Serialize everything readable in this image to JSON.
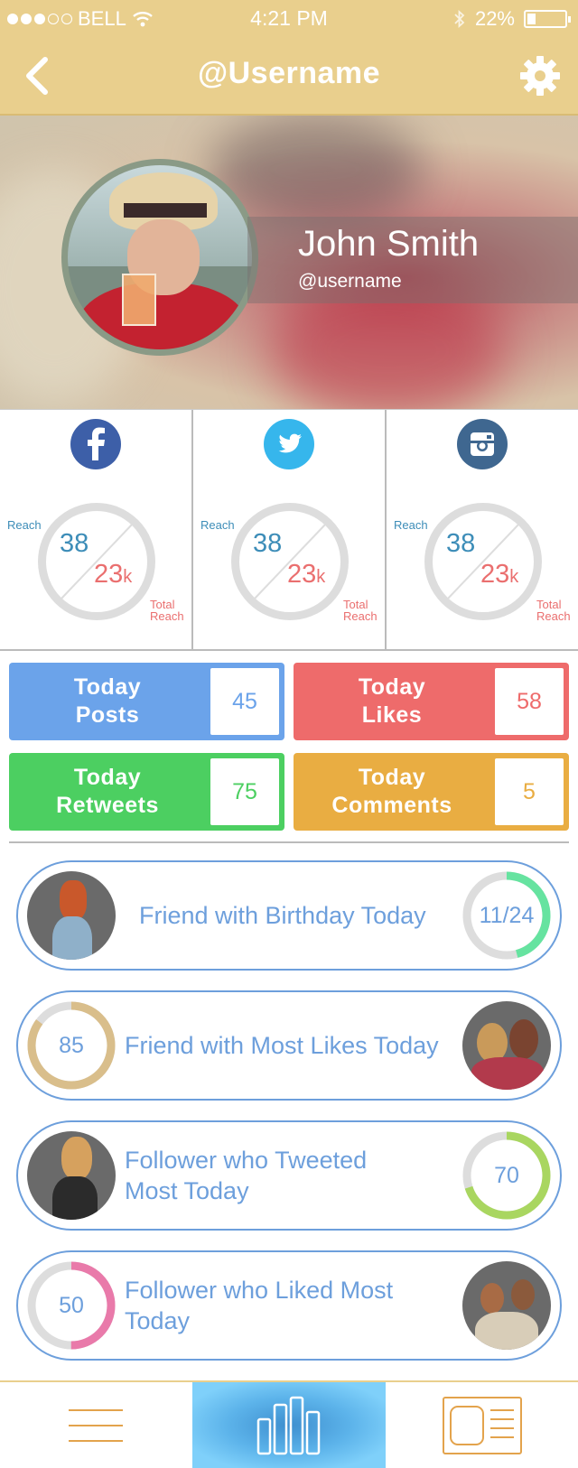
{
  "status_bar": {
    "carrier": "BELL",
    "time": "4:21 PM",
    "battery": "22%",
    "battery_level": 0.22
  },
  "header": {
    "title": "@Username"
  },
  "profile": {
    "name": "John Smith",
    "handle": "@username"
  },
  "social": [
    {
      "network": "facebook",
      "icon": "facebook-icon",
      "color": "#3d5fa8",
      "reach_label": "Reach",
      "reach": "38",
      "total": "23",
      "total_unit": "k",
      "total_label": [
        "Total",
        "Reach"
      ]
    },
    {
      "network": "twitter",
      "icon": "twitter-icon",
      "color": "#36b6ec",
      "reach_label": "Reach",
      "reach": "38",
      "total": "23",
      "total_unit": "k",
      "total_label": [
        "Total",
        "Reach"
      ]
    },
    {
      "network": "instagram",
      "icon": "instagram-icon",
      "color": "#3f6790",
      "reach_label": "Reach",
      "reach": "38",
      "total": "23",
      "total_unit": "k",
      "total_label": [
        "Total",
        "Reach"
      ]
    }
  ],
  "today": [
    {
      "label": [
        "Today",
        "Posts"
      ],
      "value": "45",
      "color": "#6ba3ea"
    },
    {
      "label": [
        "Today",
        "Likes"
      ],
      "value": "58",
      "color": "#ee6b6b"
    },
    {
      "label": [
        "Today",
        "Retweets"
      ],
      "value": "75",
      "color": "#4ccf61"
    },
    {
      "label": [
        "Today",
        "Comments"
      ],
      "value": "5",
      "color": "#e9ad42"
    }
  ],
  "cards": [
    {
      "text": [
        "Friend with Birthday Today"
      ],
      "value": "11/24",
      "fraction": 0.458,
      "progress_color": "#66e3a0"
    },
    {
      "text": [
        "Friend with Most Likes Today"
      ],
      "value": "85",
      "fraction": 0.85,
      "progress_color": "#d9be8b"
    },
    {
      "text": [
        "Follower who Tweeted",
        "Most Today"
      ],
      "value": "70",
      "fraction": 0.7,
      "progress_color": "#a9d660"
    },
    {
      "text": [
        "Follower who Liked Most",
        "Today"
      ],
      "value": "50",
      "fraction": 0.5,
      "progress_color": "#e97aaa"
    }
  ],
  "tabbar": {
    "active": "stats",
    "tabs": [
      "menu-icon",
      "bar-chart-icon",
      "news-icon"
    ]
  },
  "colors": {
    "header": "#e9cf8d",
    "card_border": "#6d9fdc",
    "tab_active": "#5cb3ea"
  }
}
